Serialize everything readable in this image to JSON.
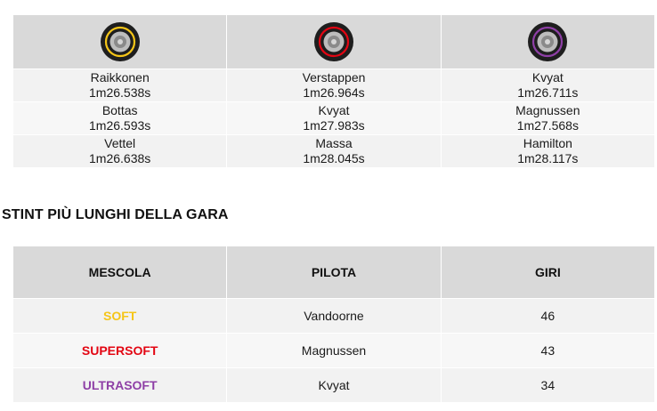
{
  "colors": {
    "soft": "#f5c518",
    "supersoft": "#e30613",
    "ultrasoft": "#8e3fa6",
    "header_bg": "#d9d9d9",
    "row_bg": "#f2f2f2"
  },
  "fastest": {
    "tyres": [
      {
        "icon": "soft-tyre-icon",
        "color": "#f5c518"
      },
      {
        "icon": "supersoft-tyre-icon",
        "color": "#e30613"
      },
      {
        "icon": "ultrasoft-tyre-icon",
        "color": "#8e3fa6"
      }
    ],
    "rows": [
      [
        {
          "driver": "Raikkonen",
          "time": "1m26.538s"
        },
        {
          "driver": "Verstappen",
          "time": "1m26.964s"
        },
        {
          "driver": "Kvyat",
          "time": "1m26.711s"
        }
      ],
      [
        {
          "driver": "Bottas",
          "time": "1m26.593s"
        },
        {
          "driver": "Kvyat",
          "time": "1m27.983s"
        },
        {
          "driver": "Magnussen",
          "time": "1m27.568s"
        }
      ],
      [
        {
          "driver": "Vettel",
          "time": "1m26.638s"
        },
        {
          "driver": "Massa",
          "time": "1m28.045s"
        },
        {
          "driver": "Hamilton",
          "time": "1m28.117s"
        }
      ]
    ]
  },
  "section_title": "STINT PIÙ LUNGHI DELLA GARA",
  "stints": {
    "headers": [
      "MESCOLA",
      "PILOTA",
      "GIRI"
    ],
    "rows": [
      {
        "compound": "SOFT",
        "driver": "Vandoorne",
        "laps": "46"
      },
      {
        "compound": "SUPERSOFT",
        "driver": "Magnussen",
        "laps": "43"
      },
      {
        "compound": "ULTRASOFT",
        "driver": "Kvyat",
        "laps": "34"
      }
    ]
  }
}
